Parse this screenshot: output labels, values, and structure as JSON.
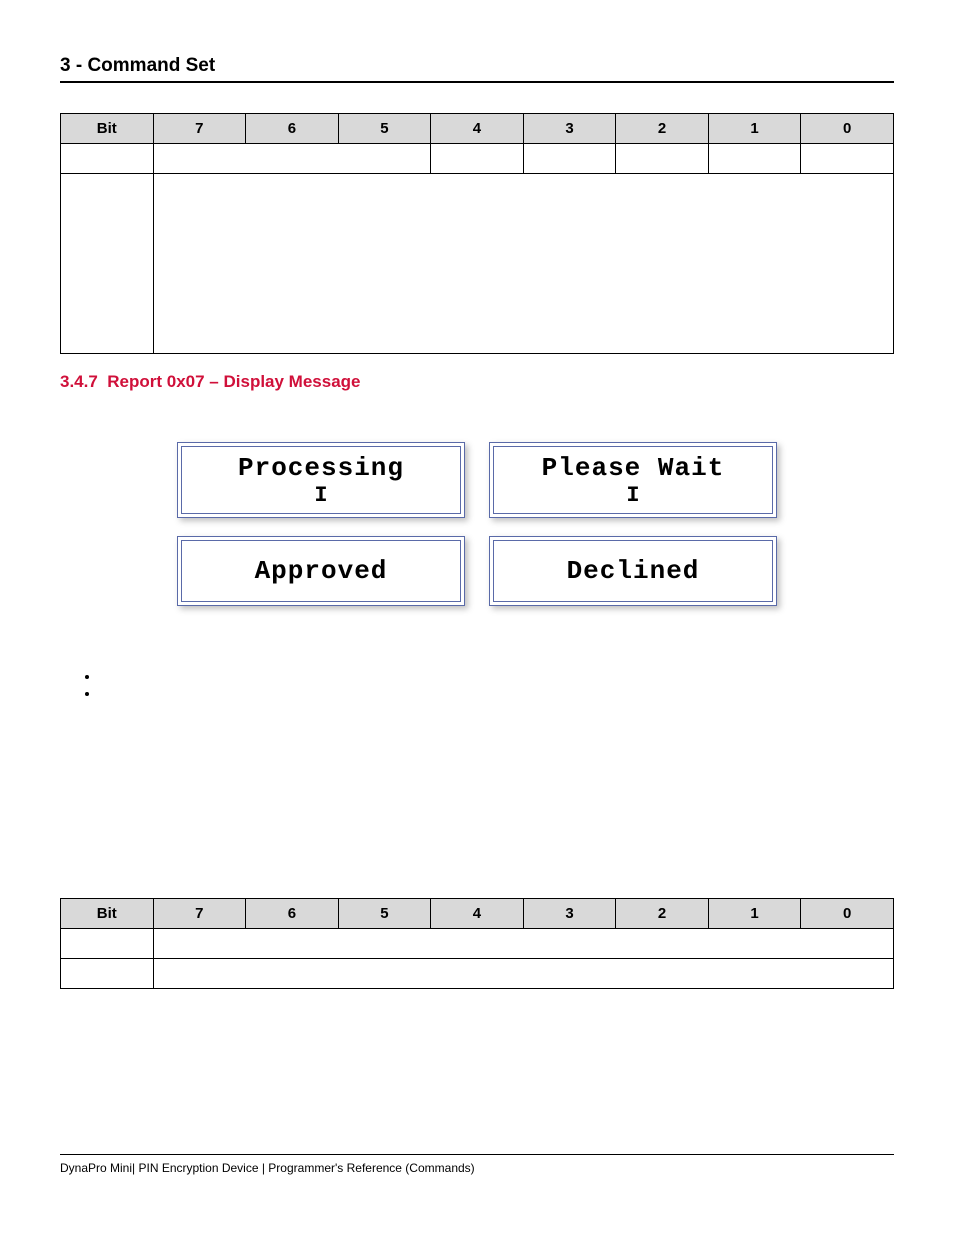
{
  "header": "3 - Command Set",
  "table1": {
    "headers": [
      "Bit",
      "7",
      "6",
      "5",
      "4",
      "3",
      "2",
      "1",
      "0"
    ]
  },
  "section": {
    "number": "3.4.7",
    "title": "Report 0x07 – Display Message"
  },
  "screens": [
    {
      "text": "Processing",
      "hourglass": true
    },
    {
      "text": "Please Wait",
      "hourglass": true
    },
    {
      "text": "Approved",
      "hourglass": false
    },
    {
      "text": "Declined",
      "hourglass": false
    }
  ],
  "dash1": "–",
  "bullets": [
    "",
    ""
  ],
  "dash2": "–",
  "table2": {
    "headers": [
      "Bit",
      "7",
      "6",
      "5",
      "4",
      "3",
      "2",
      "1",
      "0"
    ],
    "row2dash": "–"
  },
  "footer": {
    "left": "DynaPro Mini| PIN Encryption Device | Programmer's Reference (Commands)",
    "right": ""
  },
  "hourglassGlyph": "I"
}
